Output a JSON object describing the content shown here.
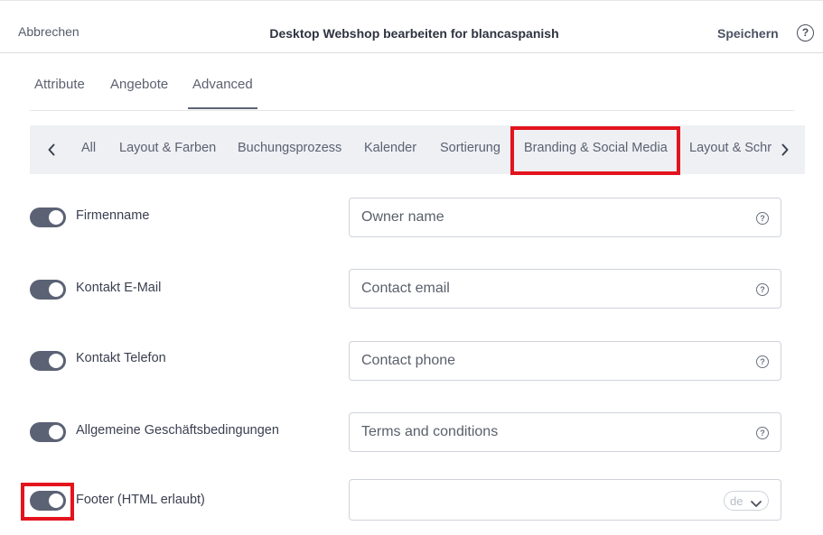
{
  "header": {
    "cancel_label": "Abbrechen",
    "title": "Desktop Webshop bearbeiten for blancaspanish",
    "save_label": "Speichern",
    "help_glyph": "?"
  },
  "tabs": [
    {
      "label": "Attribute",
      "active": false
    },
    {
      "label": "Angebote",
      "active": false
    },
    {
      "label": "Advanced",
      "active": true
    }
  ],
  "subnav": {
    "items": [
      {
        "label": "All"
      },
      {
        "label": "Layout & Farben"
      },
      {
        "label": "Buchungsprozess"
      },
      {
        "label": "Kalender"
      },
      {
        "label": "Sortierung"
      },
      {
        "label": "Branding & Social Media",
        "highlighted": true
      },
      {
        "label": "Layout & Schriften"
      }
    ],
    "prev_icon": "chevron-left-icon",
    "next_icon": "chevron-right-icon"
  },
  "settings": [
    {
      "label": "Firmenname",
      "enabled": true,
      "placeholder": "Owner name",
      "icon": "help-circle-icon"
    },
    {
      "label": "Kontakt E-Mail",
      "enabled": true,
      "placeholder": "Contact email",
      "icon": "help-circle-icon"
    },
    {
      "label": "Kontakt Telefon",
      "enabled": true,
      "placeholder": "Contact phone",
      "icon": "help-circle-icon"
    },
    {
      "label": "Allgemeine Geschäftsbedingungen",
      "enabled": true,
      "placeholder": "Terms and conditions",
      "icon": "help-circle-icon"
    },
    {
      "label": "Footer (HTML erlaubt)",
      "enabled": true,
      "placeholder": "",
      "language": "de",
      "highlighted": true
    }
  ],
  "colors": {
    "highlight": "#e3141d",
    "toggle_on": "#5b6274",
    "subnav_bg": "#eef0f4"
  }
}
